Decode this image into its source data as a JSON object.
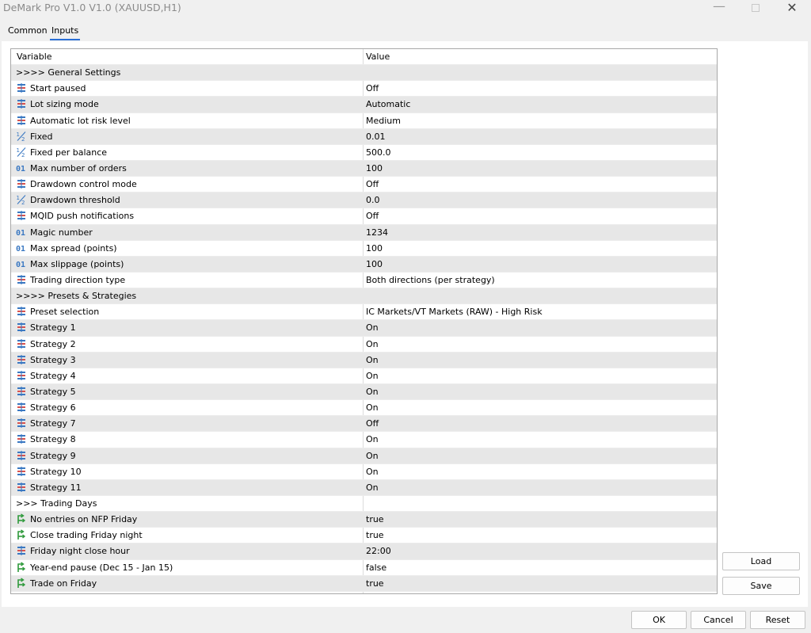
{
  "window": {
    "title": "DeMark Pro V1.0 V1.0 (XAUUSD,H1)",
    "minimize": "—",
    "close": "✕"
  },
  "tabs": [
    {
      "label": "Common"
    },
    {
      "label": "Inputs"
    }
  ],
  "grid": {
    "col1": "Variable",
    "col2": "Value"
  },
  "rows": [
    {
      "icon": "none",
      "name": ">>>> General Settings",
      "value": ""
    },
    {
      "icon": "enum",
      "name": "Start paused",
      "value": "Off"
    },
    {
      "icon": "enum",
      "name": "Lot sizing mode",
      "value": "Automatic"
    },
    {
      "icon": "enum",
      "name": "Automatic lot risk level",
      "value": "Medium"
    },
    {
      "icon": "double",
      "name": "Fixed",
      "value": "0.01"
    },
    {
      "icon": "double",
      "name": "Fixed per balance",
      "value": "500.0"
    },
    {
      "icon": "int",
      "name": "Max number of orders",
      "value": "100"
    },
    {
      "icon": "enum",
      "name": "Drawdown control mode",
      "value": "Off"
    },
    {
      "icon": "double",
      "name": "Drawdown threshold",
      "value": "0.0"
    },
    {
      "icon": "enum",
      "name": "MQID push notifications",
      "value": "Off"
    },
    {
      "icon": "int",
      "name": "Magic number",
      "value": "1234"
    },
    {
      "icon": "int",
      "name": "Max spread (points)",
      "value": "100"
    },
    {
      "icon": "int",
      "name": "Max slippage (points)",
      "value": "100"
    },
    {
      "icon": "enum",
      "name": "Trading direction type",
      "value": "Both directions (per strategy)"
    },
    {
      "icon": "none",
      "name": ">>>> Presets & Strategies",
      "value": ""
    },
    {
      "icon": "enum",
      "name": "Preset selection",
      "value": "IC Markets/VT Markets (RAW) - High Risk"
    },
    {
      "icon": "enum",
      "name": "Strategy 1",
      "value": "On"
    },
    {
      "icon": "enum",
      "name": "Strategy 2",
      "value": "On"
    },
    {
      "icon": "enum",
      "name": "Strategy 3",
      "value": "On"
    },
    {
      "icon": "enum",
      "name": "Strategy 4",
      "value": "On"
    },
    {
      "icon": "enum",
      "name": "Strategy 5",
      "value": "On"
    },
    {
      "icon": "enum",
      "name": "Strategy 6",
      "value": "On"
    },
    {
      "icon": "enum",
      "name": "Strategy 7",
      "value": "Off"
    },
    {
      "icon": "enum",
      "name": "Strategy 8",
      "value": "On"
    },
    {
      "icon": "enum",
      "name": "Strategy 9",
      "value": "On"
    },
    {
      "icon": "enum",
      "name": "Strategy 10",
      "value": "On"
    },
    {
      "icon": "enum",
      "name": "Strategy 11",
      "value": "On"
    },
    {
      "icon": "none",
      "name": ">>> Trading Days",
      "value": ""
    },
    {
      "icon": "bool",
      "name": "No entries on NFP Friday",
      "value": "true"
    },
    {
      "icon": "bool",
      "name": "Close trading Friday night",
      "value": "true"
    },
    {
      "icon": "enum",
      "name": "Friday night close hour",
      "value": "22:00"
    },
    {
      "icon": "bool",
      "name": "Year-end pause (Dec 15 - Jan 15)",
      "value": "false"
    },
    {
      "icon": "bool",
      "name": "Trade on Friday",
      "value": "true"
    }
  ],
  "buttons": {
    "load": "Load",
    "save": "Save",
    "ok": "OK",
    "cancel": "Cancel",
    "reset": "Reset"
  },
  "colors": {
    "accent": "#2a6fd6",
    "enum_red": "#d9534f",
    "enum_blue": "#3a78c2",
    "bool_green": "#2f9a3c"
  }
}
